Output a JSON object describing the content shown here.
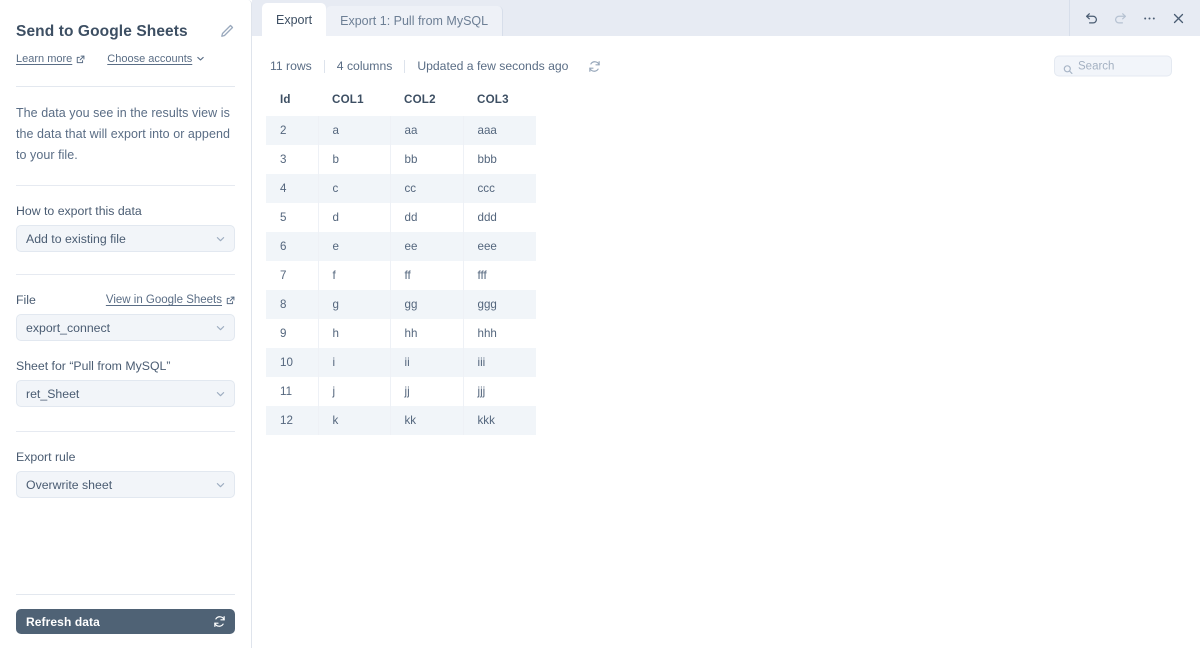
{
  "sidebar": {
    "title": "Send to Google Sheets",
    "edit_icon": "pencil-icon",
    "links": [
      {
        "label": "Learn more",
        "icon": "external-link-icon"
      },
      {
        "label": "Choose accounts",
        "icon": "chevron-down-icon"
      }
    ],
    "info_text": "The data you see in the results view is the data that will export into or append to your file.",
    "fields": [
      {
        "label": "How to export this data",
        "value": "Add to existing file"
      },
      {
        "label": "File",
        "link": "View in Google Sheets",
        "link_icon": "external-link-icon",
        "value": "export_connect"
      },
      {
        "label": "Sheet for “Pull from MySQL”",
        "value": "ret_Sheet"
      },
      {
        "label": "Export rule",
        "value": "Overwrite sheet"
      }
    ],
    "refresh_button": {
      "label": "Refresh data",
      "icon": "refresh-icon"
    }
  },
  "topbar": {
    "tabs": [
      {
        "label": "Export",
        "active": true
      },
      {
        "label": "Export 1: Pull from MySQL",
        "active": false
      }
    ],
    "window_controls": [
      {
        "name": "undo-icon",
        "state": "enabled"
      },
      {
        "name": "redo-icon",
        "state": "disabled"
      },
      {
        "name": "more-options-icon",
        "state": "enabled"
      },
      {
        "name": "close-icon",
        "state": "enabled"
      }
    ]
  },
  "meta": {
    "rows": "11 rows",
    "columns": "4 columns",
    "updated": "Updated a few seconds ago",
    "refresh_icon": "refresh-icon"
  },
  "search": {
    "placeholder": "Search",
    "value": "",
    "icon": "search-icon"
  },
  "table": {
    "headers": [
      "Id",
      "COL1",
      "COL2",
      "COL3"
    ],
    "rows": [
      [
        "2",
        "a",
        "aa",
        "aaa"
      ],
      [
        "3",
        "b",
        "bb",
        "bbb"
      ],
      [
        "4",
        "c",
        "cc",
        "ccc"
      ],
      [
        "5",
        "d",
        "dd",
        "ddd"
      ],
      [
        "6",
        "e",
        "ee",
        "eee"
      ],
      [
        "7",
        "f",
        "ff",
        "fff"
      ],
      [
        "8",
        "g",
        "gg",
        "ggg"
      ],
      [
        "9",
        "h",
        "hh",
        "hhh"
      ],
      [
        "10",
        "i",
        "ii",
        "iii"
      ],
      [
        "11",
        "j",
        "jj",
        "jjj"
      ],
      [
        "12",
        "k",
        "kk",
        "kkk"
      ]
    ]
  },
  "colors": {
    "topbar_bg": "#e7ebf3",
    "accent_dark": "#4f6275",
    "text_primary": "#3d4f63",
    "text_secondary": "#5a6d85",
    "row_stripe": "#f1f5f9",
    "field_bg": "#f2f5f9"
  }
}
